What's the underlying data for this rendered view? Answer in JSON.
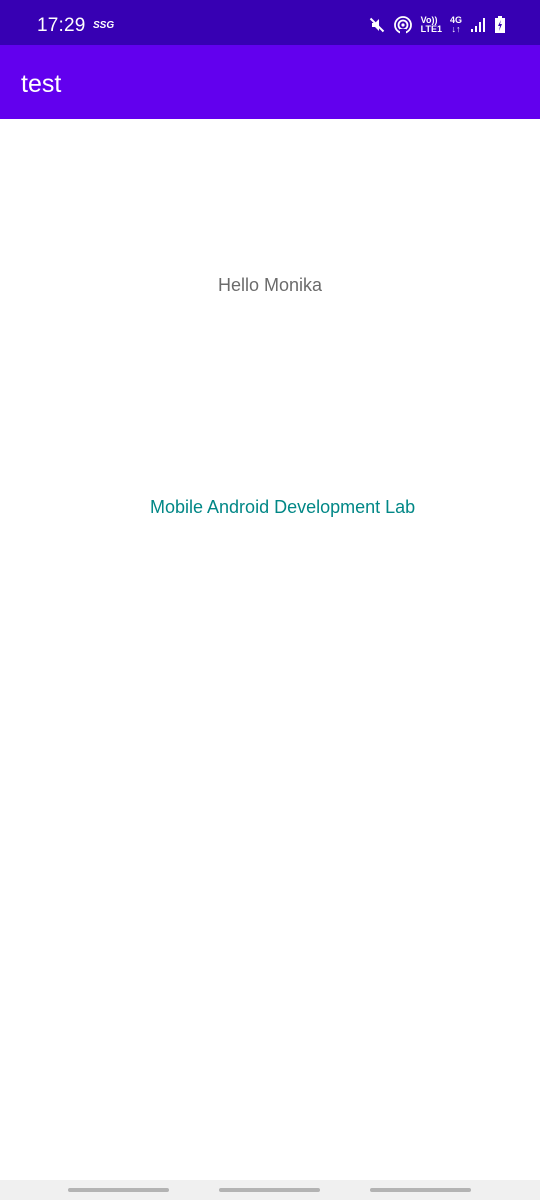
{
  "status_bar": {
    "time": "17:29",
    "carrier_badge": "SSG",
    "volte_top": "Vo))",
    "volte_bottom": "LTE1",
    "network_type": "4G",
    "network_arrows": "↓↑",
    "icons": [
      "mute-icon",
      "hotspot-icon",
      "volte-icon",
      "network-4g-icon",
      "signal-icon",
      "battery-icon"
    ]
  },
  "app_bar": {
    "title": "test"
  },
  "main": {
    "greeting": "Hello Monika",
    "subtitle": "Mobile Android Development Lab"
  },
  "colors": {
    "status_bar": "#3700b3",
    "app_bar": "#6200ee",
    "greeting_text": "#6b6b6b",
    "subtitle_text": "#018786"
  }
}
